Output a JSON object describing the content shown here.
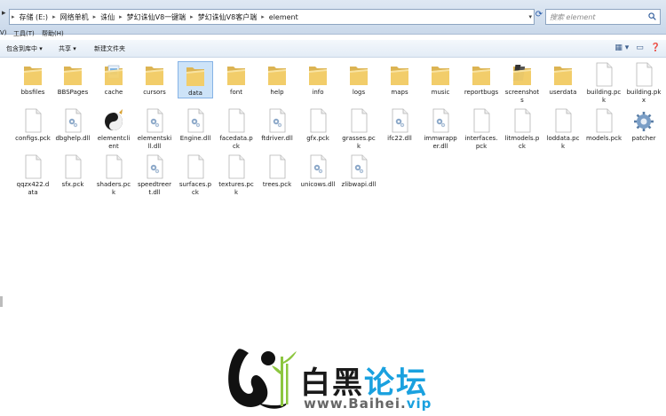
{
  "address": {
    "crumbs": [
      "存储 (E:)",
      "网络单机",
      "诛仙",
      "梦幻诛仙V8一键端",
      "梦幻诛仙V8客户端",
      "element"
    ],
    "search_placeholder": "搜索 element"
  },
  "menu": {
    "clip": "V)",
    "tools": "工具(T)",
    "help": "帮助(H)"
  },
  "toolbar": {
    "include": "包含到库中 ▾",
    "share": "共享 ▾",
    "new_folder": "新建文件夹"
  },
  "files": [
    {
      "name": "bbsfiles",
      "type": "folder"
    },
    {
      "name": "BBSPages",
      "type": "folder"
    },
    {
      "name": "cache",
      "type": "folder-img"
    },
    {
      "name": "cursors",
      "type": "folder"
    },
    {
      "name": "data",
      "type": "folder",
      "selected": true
    },
    {
      "name": "font",
      "type": "folder"
    },
    {
      "name": "help",
      "type": "folder"
    },
    {
      "name": "info",
      "type": "folder"
    },
    {
      "name": "logs",
      "type": "folder"
    },
    {
      "name": "maps",
      "type": "folder"
    },
    {
      "name": "music",
      "type": "folder"
    },
    {
      "name": "reportbugs",
      "type": "folder"
    },
    {
      "name": "screenshots",
      "type": "folder-dark"
    },
    {
      "name": "userdata",
      "type": "folder"
    },
    {
      "name": "building.pck",
      "type": "file"
    },
    {
      "name": "building.pkx",
      "type": "file"
    },
    {
      "name": "configs.pck",
      "type": "file"
    },
    {
      "name": "dbghelp.dll",
      "type": "dll"
    },
    {
      "name": "elementclient",
      "type": "exe"
    },
    {
      "name": "elementskill.dll",
      "type": "dll"
    },
    {
      "name": "Engine.dll",
      "type": "dll"
    },
    {
      "name": "facedata.pck",
      "type": "file"
    },
    {
      "name": "ftdriver.dll",
      "type": "dll"
    },
    {
      "name": "gfx.pck",
      "type": "file"
    },
    {
      "name": "grasses.pck",
      "type": "file"
    },
    {
      "name": "ifc22.dll",
      "type": "dll"
    },
    {
      "name": "immwrapper.dll",
      "type": "dll"
    },
    {
      "name": "interfaces.pck",
      "type": "file"
    },
    {
      "name": "litmodels.pck",
      "type": "file"
    },
    {
      "name": "loddata.pck",
      "type": "file"
    },
    {
      "name": "models.pck",
      "type": "file"
    },
    {
      "name": "patcher",
      "type": "patcher"
    },
    {
      "name": "qqzx422.data",
      "type": "file"
    },
    {
      "name": "sfx.pck",
      "type": "file"
    },
    {
      "name": "shaders.pck",
      "type": "file"
    },
    {
      "name": "speedtreert.dll",
      "type": "dll"
    },
    {
      "name": "surfaces.pck",
      "type": "file"
    },
    {
      "name": "textures.pck",
      "type": "file"
    },
    {
      "name": "trees.pck",
      "type": "file"
    },
    {
      "name": "unicows.dll",
      "type": "dll"
    },
    {
      "name": "zlibwapi.dll",
      "type": "dll"
    }
  ],
  "watermark": {
    "name_a": "白黑",
    "name_b": "论坛",
    "url_a": "www.Baihei.",
    "url_b": "vip"
  },
  "colors": {
    "folder": "#f2cf6b",
    "accent": "#1aa1df",
    "selection": "#cde3f8"
  }
}
